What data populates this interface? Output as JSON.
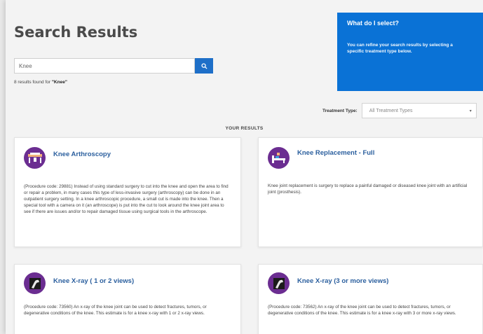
{
  "header": {
    "title": "Search Results"
  },
  "search": {
    "value": "Knee",
    "button_icon": "search-icon"
  },
  "results_summary": {
    "prefix": "8 results found for ",
    "query": "\"Knee\""
  },
  "help": {
    "title": "What do I select?",
    "text": "You can refine your search results by selecting a specific treatment type below."
  },
  "filter": {
    "label": "Treatment Type:",
    "selected": "All Treatment Types"
  },
  "results_heading": "YOUR RESULTS",
  "cards": [
    {
      "title": "Knee Arthroscopy",
      "icon": "surgery-table-icon",
      "description": "(Procedure code: 29881) Instead of using standard surgery to cut into the knee and open the area to find or repair a problem, in many cases this type of less-invasive surgery (arthroscopy) can be done in an outpatient surgery setting. In a knee arthroscopic procedure, a small cut is made into the knee. Then a special tool with a camera on it (an arthroscope) is put into the cut to look around the knee joint area to see if there are issues and/or to repair damaged tissue using surgical tools in the arthroscope."
    },
    {
      "title": "Knee Replacement - Full",
      "icon": "hospital-bed-icon",
      "description": "Knee joint replacement is surgery to replace a painful damaged or diseased knee joint with an artificial joint (prosthesis)."
    },
    {
      "title": "Knee X-ray ( 1 or 2 views)",
      "icon": "xray-knee-icon",
      "description": "(Procedure code: 73560) An x-ray of the knee joint can be used to detect fractures, tumors, or degenerative conditions of the knee. This estimate is for a knee x-ray with 1 or 2 x-ray views."
    },
    {
      "title": "Knee X-ray (3 or more views)",
      "icon": "xray-knee-icon",
      "description": "(Procedure code: 73562) An x-ray of the knee joint can be used to detect fractures, tumors, or degenerative conditions of the knee. This estimate is for a knee x-ray with 3 or more x-ray views."
    }
  ],
  "colors": {
    "accent_blue": "#0a72d6",
    "icon_purple": "#6b2d91",
    "link_blue": "#2b5f9e"
  }
}
